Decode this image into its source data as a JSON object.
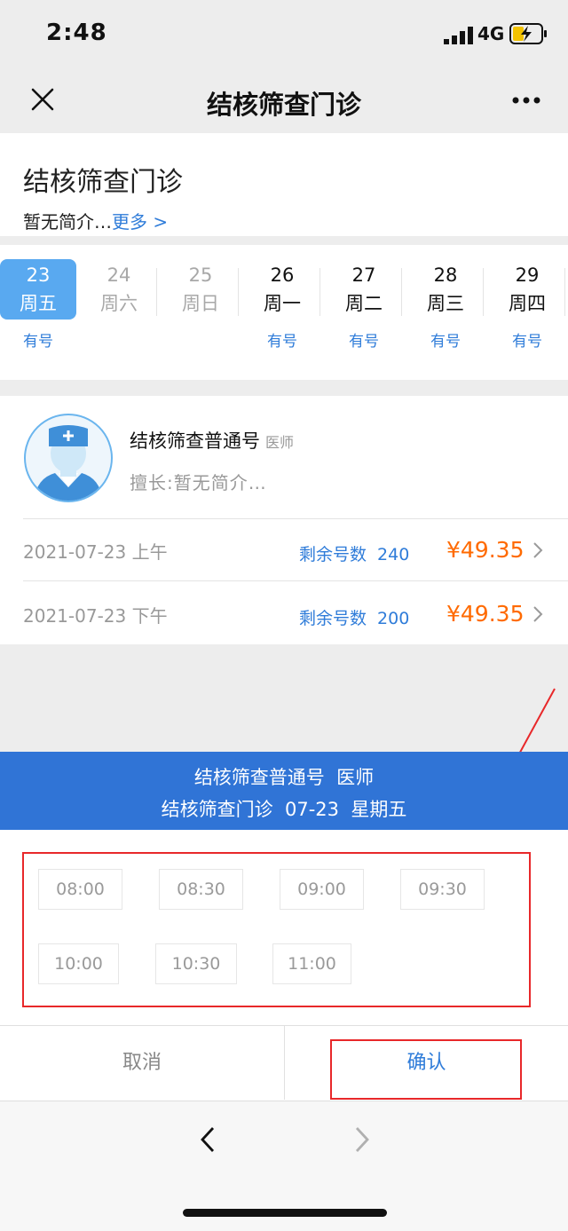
{
  "status": {
    "time": "2:48",
    "network": "4G"
  },
  "nav": {
    "title": "结核筛查门诊"
  },
  "clinic": {
    "name": "结核筛查门诊",
    "intro": "暂无简介…",
    "more": "更多 >"
  },
  "dates": [
    {
      "date": "23",
      "weekday": "周五",
      "avail": "有号"
    },
    {
      "date": "24",
      "weekday": "周六",
      "avail": ""
    },
    {
      "date": "25",
      "weekday": "周日",
      "avail": ""
    },
    {
      "date": "26",
      "weekday": "周一",
      "avail": "有号"
    },
    {
      "date": "27",
      "weekday": "周二",
      "avail": "有号"
    },
    {
      "date": "28",
      "weekday": "周三",
      "avail": "有号"
    },
    {
      "date": "29",
      "weekday": "周四",
      "avail": "有号"
    }
  ],
  "doctor": {
    "name": "结核筛查普通号",
    "title": "医师",
    "specialty": "擅长:暂无简介…"
  },
  "slots": [
    {
      "date": "2021-07-23 上午",
      "remaining_label": "剩余号数",
      "remaining": "240",
      "price": "¥49.35"
    },
    {
      "date": "2021-07-23 下午",
      "remaining_label": "剩余号数",
      "remaining": "200",
      "price": "¥49.35"
    }
  ],
  "sheet": {
    "line1": "结核筛查普通号  医师",
    "line2": "结核筛查门诊  07-23  星期五",
    "times": [
      "08:00",
      "08:30",
      "09:00",
      "09:30",
      "10:00",
      "10:30",
      "11:00"
    ],
    "cancel": "取消",
    "confirm": "确认"
  },
  "colors": {
    "accent": "#2f7cd9",
    "price": "#ff6a00",
    "header": "#3074d6",
    "highlight": "#e8282a"
  }
}
